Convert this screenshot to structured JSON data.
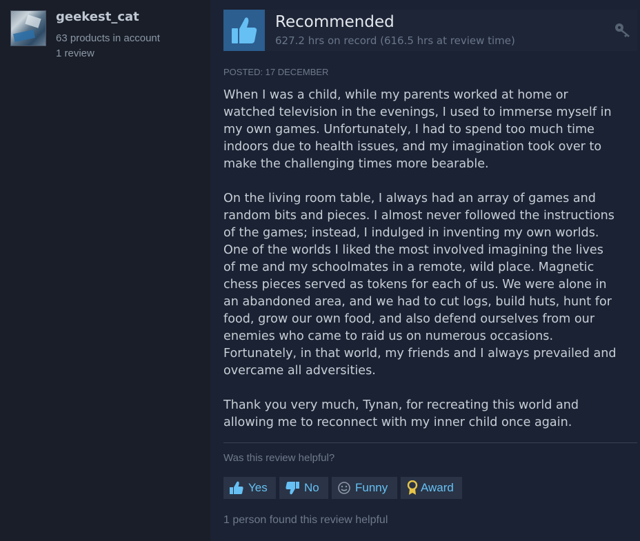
{
  "reviewer": {
    "username": "geekest_cat",
    "products": "63 products in account",
    "reviews": "1 review"
  },
  "review": {
    "verdict": "Recommended",
    "hours": "627.2 hrs on record (616.5 hrs at review time)",
    "posted": "POSTED: 17 DECEMBER",
    "paragraphs": [
      "When I was a child, while my parents worked at home or\nwatched television in the evenings, I used to immerse myself in\nmy own games. Unfortunately, I had to spend too much time\nindoors due to health issues, and my imagination took over to\nmake the challenging times more bearable.",
      "On the living room table, I always had an array of games and\nrandom bits and pieces. I almost never followed the instructions\nof the games; instead, I indulged in inventing my own worlds.\nOne of the worlds I liked the most involved imagining the lives\nof me and my schoolmates in a remote, wild place. Magnetic\nchess pieces served as tokens for each of us. We were alone in\nan abandoned area, and we had to cut logs, build huts, hunt for\nfood, grow our own food, and also defend ourselves from our\nenemies who came to raid us on numerous occasions.\nFortunately, in that world, my friends and I always prevailed and\novercame all adversities.",
      "Thank you very much, Tynan, for recreating this world and\nallowing me to reconnect with my inner child once again."
    ]
  },
  "feedback": {
    "question": "Was this review helpful?",
    "yes": "Yes",
    "no": "No",
    "funny": "Funny",
    "award": "Award",
    "found_helpful": "1 person found this review helpful"
  },
  "icons": {
    "thumbs_up": "thumbs-up-icon",
    "thumbs_down": "thumbs-down-icon",
    "funny": "smiley-icon",
    "award": "award-icon",
    "key": "key-icon"
  },
  "colors": {
    "accent_link": "#66c0f4",
    "recommend_box": "#2c5e8f",
    "text": "#c7ced6"
  }
}
